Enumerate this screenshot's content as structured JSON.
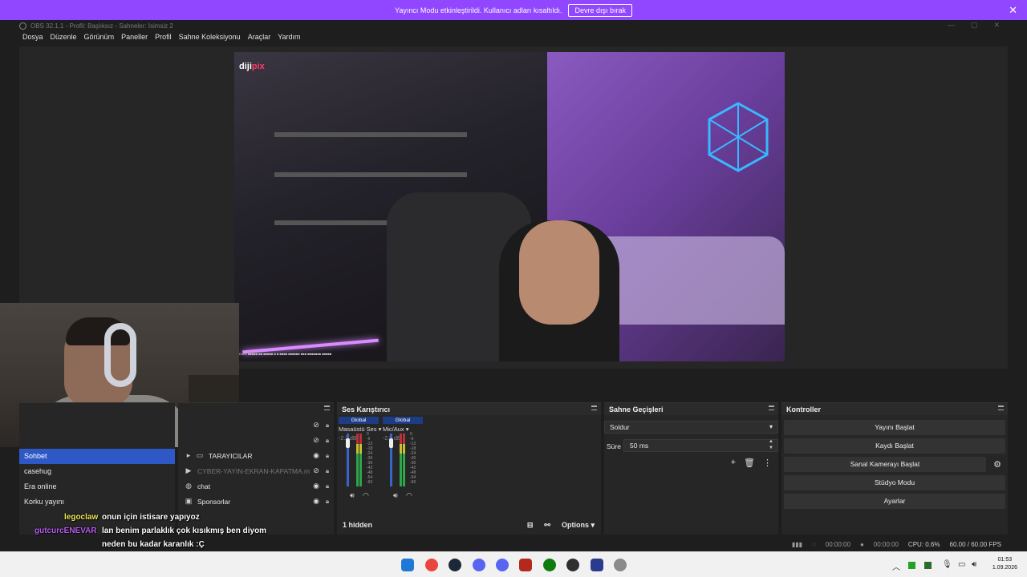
{
  "banner": {
    "message": "Yayıncı Modu etkinleştirildi. Kullanıcı adları kısaltıldı.",
    "button": "Devre dışı bırak"
  },
  "titlebar": {
    "title": "OBS 32.1.1 - Profil: Başlıksız - Sahneler: İsimsiz 2"
  },
  "menu": [
    "Dosya",
    "Düzenle",
    "Görünüm",
    "Paneller",
    "Profil",
    "Sahne Koleksiyonu",
    "Araçlar",
    "Yardım"
  ],
  "preview": {
    "brand_a": "diji",
    "brand_b": "pix",
    "overlay_text": "Kazılı ■■■■■ ■■ ■■■■■ ■ ■ ■■■■ ■■■■■■ ■■■ ■■■■■■■ ■■■■■"
  },
  "scenes": {
    "items": [
      "Sohbet",
      "casehug",
      "Era online",
      "Korku yayını"
    ],
    "selected": 0
  },
  "sources": {
    "rows": [
      {
        "label": "TARAYICILAR",
        "icon": "folder-icon",
        "visible": true,
        "dim": false
      },
      {
        "label": "CYBER-YAYIN-EKRAN-KAPATMA.m",
        "icon": "media-icon",
        "visible": false,
        "dim": true
      },
      {
        "label": "chat",
        "icon": "browser-icon",
        "visible": true,
        "dim": false
      },
      {
        "label": "Sponsorlar",
        "icon": "image-icon",
        "visible": true,
        "dim": false
      }
    ]
  },
  "mixer": {
    "title": "Ses Karıştırıcı",
    "channels": [
      {
        "tag": "Global",
        "name": "Masaüstü Ses",
        "db": "-2.2 dB"
      },
      {
        "tag": "Global",
        "name": "Mic/Aux",
        "db": "-2.5 dB"
      }
    ],
    "ticks": [
      "0",
      "-6",
      "-12",
      "-18",
      "-24",
      "-30",
      "-36",
      "-42",
      "-48",
      "-54",
      "-60"
    ],
    "hidden_label": "1 hidden",
    "options_label": "Options"
  },
  "transitions": {
    "title": "Sahne Geçişleri",
    "selected": "Soldur",
    "duration_label": "Süre",
    "duration_value": "50 ms"
  },
  "controls": {
    "title": "Kontroller",
    "buttons": [
      "Yayını Başlat",
      "Kaydı Başlat",
      "Sanal Kamerayı Başlat",
      "Stüdyo Modu",
      "Ayarlar"
    ]
  },
  "status": {
    "stream_time": "00:00:00",
    "rec_time": "00:00:00",
    "cpu": "CPU: 0.6%",
    "fps": "60.00 / 60.00 FPS"
  },
  "chat": {
    "line1_user": "legoclaw",
    "line1_text": "onun için istisare yapıyoz",
    "line2_user": "gutcurcENEVAR",
    "line2_text": "lan benim parlaklık çok kısıkmış ben diyom",
    "line3_text": "neden bu kadar karanlık :Ç"
  },
  "taskbar": {
    "time": "01:53",
    "date": "1.09.2026"
  },
  "colors": {
    "banner": "#9146ff",
    "selection": "#2f58c7",
    "global_tag": "#1d3c86"
  }
}
